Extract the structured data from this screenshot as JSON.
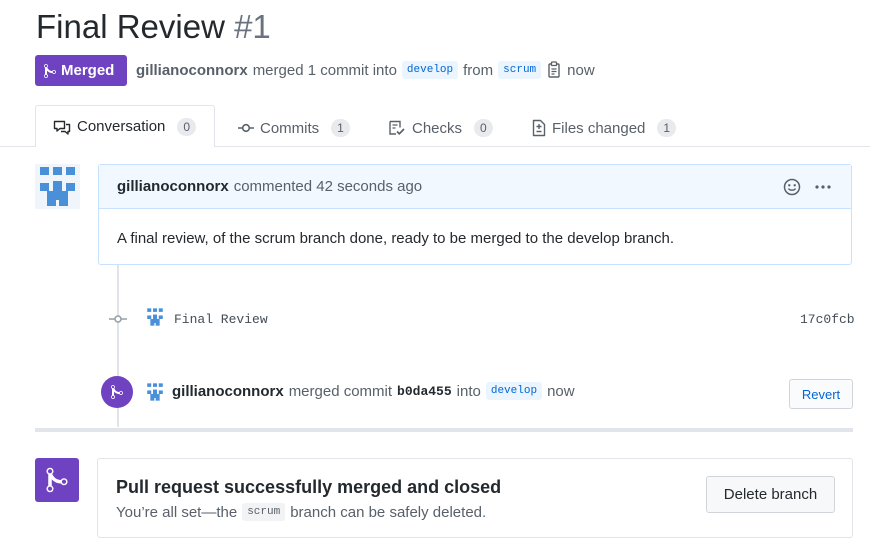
{
  "pr": {
    "title": "Final Review",
    "number": "#1",
    "state_label": "Merged",
    "author": "gillianoconnorx",
    "merge_text": "merged 1 commit into",
    "base_branch": "develop",
    "from_text": "from",
    "head_branch": "scrum",
    "time": "now"
  },
  "tabs": [
    {
      "label": "Conversation",
      "count": "0"
    },
    {
      "label": "Commits",
      "count": "1"
    },
    {
      "label": "Checks",
      "count": "0"
    },
    {
      "label": "Files changed",
      "count": "1"
    }
  ],
  "comment": {
    "author": "gillianoconnorx",
    "action": "commented 42 seconds ago",
    "body": "A final review, of the scrum branch done, ready to be merged to the develop branch."
  },
  "commit": {
    "message": "Final Review",
    "sha": "17c0fcb"
  },
  "merge_event": {
    "user": "gillianoconnorx",
    "text": "merged commit",
    "sha": "b0da455",
    "into": "into",
    "branch": "develop",
    "time": "now",
    "revert_label": "Revert"
  },
  "merged_box": {
    "title": "Pull request successfully merged and closed",
    "sub_prefix": "You’re all set—the",
    "branch": "scrum",
    "sub_suffix": "branch can be safely deleted.",
    "delete_label": "Delete branch"
  },
  "colors": {
    "merged_purple": "#6f42c1",
    "link_blue": "#0366d6",
    "avatar_blue": "#4a90d9"
  }
}
